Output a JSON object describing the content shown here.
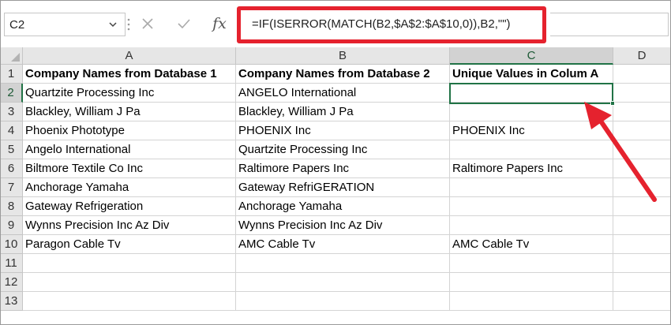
{
  "formula_bar": {
    "name_box": "C2",
    "fx_label": "fx",
    "formula": "=IF(ISERROR(MATCH(B2,$A$2:$A$10,0)),B2,\"\")"
  },
  "columns": [
    "A",
    "B",
    "C",
    "D"
  ],
  "selected_column": "C",
  "rows": [
    "1",
    "2",
    "3",
    "4",
    "5",
    "6",
    "7",
    "8",
    "9",
    "10",
    "11",
    "12",
    "13"
  ],
  "selected_row": "2",
  "cells": {
    "A": [
      "Company Names from Database 1",
      "Quartzite Processing Inc",
      "Blackley, William J Pa",
      "Phoenix Phototype",
      "Angelo International",
      "Biltmore Textile Co Inc",
      "Anchorage Yamaha",
      "Gateway Refrigeration",
      "Wynns Precision Inc Az Div",
      "Paragon Cable Tv",
      "",
      "",
      ""
    ],
    "B": [
      "Company Names from Database 2",
      "ANGELO International",
      "Blackley, William J Pa",
      "PHOENIX Inc",
      "Quartzite Processing Inc",
      "Raltimore Papers Inc",
      "Gateway RefriGERATION",
      "Anchorage Yamaha",
      "Wynns Precision Inc Az Div",
      "AMC Cable Tv",
      "",
      "",
      ""
    ],
    "C": [
      "Unique Values in Colum A",
      "",
      "",
      "PHOENIX Inc",
      "",
      "Raltimore Papers Inc",
      "",
      "",
      "",
      "AMC Cable Tv",
      "",
      "",
      ""
    ],
    "D": [
      "",
      "",
      "",
      "",
      "",
      "",
      "",
      "",
      "",
      "",
      "",
      "",
      ""
    ]
  },
  "colors": {
    "highlight_red": "#e5222e",
    "excel_green": "#217346"
  },
  "icons": [
    "chevron-down-icon",
    "cancel-icon",
    "enter-icon",
    "fx-icon"
  ]
}
